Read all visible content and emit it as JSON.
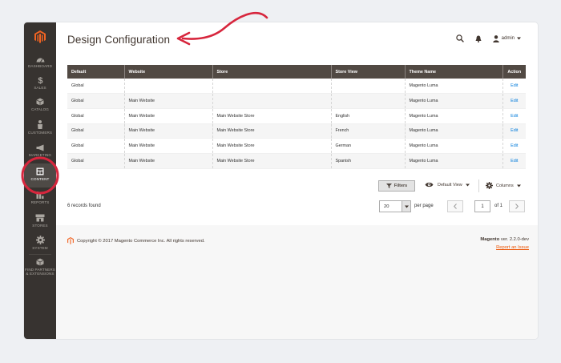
{
  "sidebar": {
    "items": [
      {
        "label": "DASHBOARD",
        "icon": "dashboard-icon"
      },
      {
        "label": "SALES",
        "icon": "dollar-icon"
      },
      {
        "label": "CATALOG",
        "icon": "cube-icon"
      },
      {
        "label": "CUSTOMERS",
        "icon": "person-icon"
      },
      {
        "label": "MARKETING",
        "icon": "megaphone-icon"
      },
      {
        "label": "CONTENT",
        "icon": "content-icon"
      },
      {
        "label": "REPORTS",
        "icon": "bar-chart-icon"
      },
      {
        "label": "STORES",
        "icon": "store-icon"
      },
      {
        "label": "SYSTEM",
        "icon": "gear-icon"
      },
      {
        "label1": "FIND PARTNERS",
        "label2": "& EXTENSIONS",
        "icon": "partners-icon"
      }
    ],
    "active": "CONTENT"
  },
  "header": {
    "title": "Design Configuration",
    "user": "admin"
  },
  "grid": {
    "columns": [
      "Default",
      "Website",
      "Store",
      "Store View",
      "Theme Name",
      "Action"
    ],
    "rows": [
      [
        "Global",
        "",
        "",
        "",
        "Magento Luma",
        "Edit"
      ],
      [
        "Global",
        "Main Website",
        "",
        "",
        "Magento Luma",
        "Edit"
      ],
      [
        "Global",
        "Main Website",
        "Main Website Store",
        "English",
        "Magento Luma",
        "Edit"
      ],
      [
        "Global",
        "Main Website",
        "Main Website Store",
        "French",
        "Magento Luma",
        "Edit"
      ],
      [
        "Global",
        "Main Website",
        "Main Website Store",
        "German",
        "Magento Luma",
        "Edit"
      ],
      [
        "Global",
        "Main Website",
        "Main Website Store",
        "Spanish",
        "Magento Luma",
        "Edit"
      ]
    ]
  },
  "controls": {
    "filters": "Filters",
    "view": "Default View",
    "columns": "Columns",
    "records": "6 records found",
    "per_page_value": "20",
    "per_page_label": "per page",
    "page_value": "1",
    "page_of": "of 1"
  },
  "footer": {
    "copyright": "Copyright © 2017 Magento Commerce Inc. All rights reserved.",
    "brand": "Magento",
    "version": " ver. 2.2.0-dev",
    "report": "Report an Issue"
  },
  "colors": {
    "sidebar": "#373330",
    "header_row": "#514943",
    "accent": "#eb5202",
    "annotation": "#d7263d",
    "link": "#007bdb"
  }
}
